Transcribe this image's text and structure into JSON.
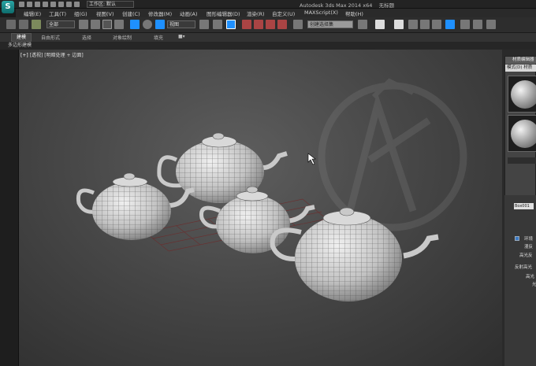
{
  "titlebar": {
    "logo_letter": "S",
    "workspace": "工作区: 默认",
    "app_title": "Autodesk 3ds Max  2014 x64",
    "doc_title": "无标题"
  },
  "menu": {
    "items": [
      "编辑(E)",
      "工具(T)",
      "组(G)",
      "视图(V)",
      "创建(C)",
      "修改器(M)",
      "动画(A)",
      "图形编辑器(D)",
      "渲染(R)",
      "自定义(U)",
      "MAXScript(X)",
      "帮助(H)"
    ]
  },
  "toolbar": {
    "filter_value": "全部",
    "coord_value": "视图",
    "named_sel_value": "创建选择集"
  },
  "ribbon": {
    "tabs": [
      "建模",
      "自由形式",
      "选择",
      "对象绘制",
      "填充"
    ],
    "active_tab": "建模",
    "sub_label": "多边形建模"
  },
  "viewport": {
    "label_plus": "[+]",
    "label_view": "[透视]",
    "label_shading": "[明暗处理 + 边面]"
  },
  "material_editor": {
    "title": "材质编辑器",
    "menu_text": "模式(D)  材质"
  },
  "command_panel": {
    "field_value": "Box001",
    "lines": [
      "环境",
      "漫反",
      "高光反",
      "反射高光",
      "高光",
      "光"
    ]
  },
  "colors": {
    "accent": "#1e90ff",
    "viewport_bg": "#474747",
    "logo_teal": "#1a8a8a"
  }
}
